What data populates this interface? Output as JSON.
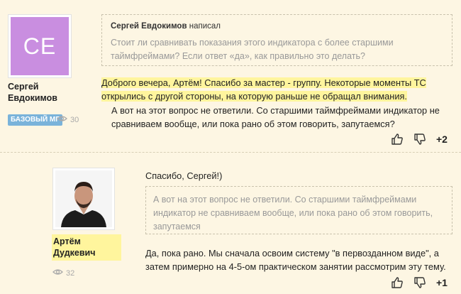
{
  "post1": {
    "avatar_initials": "CE",
    "avatar_color": "#c98ee0",
    "author_name": "Сергей Евдокимов",
    "badge": "БАЗОВЫЙ МГ",
    "views": "30",
    "quote": {
      "author": "Сергей Евдокимов",
      "verb": "написал",
      "text": "Стоит ли сравнивать показания этого индикатора с более старшими таймфреймами? Если ответ «да», как правильно это делать?"
    },
    "highlighted_text": "Доброго вечера, Артём! Спасибо за мастер - группу. Некоторые моменты ТС открылись с другой стороны, на которую раньше не обращал внимания.",
    "text": "А вот на этот вопрос не ответили. Со старшими таймфреймами индикатор не сравниваем вообще, или пока рано об этом говорить, запутаемся?",
    "votes": "+2"
  },
  "post2": {
    "author_name": "Артём Дудкевич",
    "views": "32",
    "greeting": "Спасибо, Сергей!)",
    "quote_text": "А вот на этот вопрос не ответили. Со старшими таймфреймами индикатор не сравниваем вообще, или пока рано об этом говорить, запутаемся",
    "text": "Да, пока рано. Мы сначала освоим систему \"в первозданном виде\", а затем примерно на 4-5-ом практическом занятии рассмотрим эту тему.",
    "votes": "+1"
  },
  "colors": {
    "background": "#fdf6e3",
    "highlight": "#fff59d",
    "badge": "#7ab3da"
  },
  "icons": [
    "eye-icon",
    "thumbs-up-icon",
    "thumbs-down-icon"
  ]
}
